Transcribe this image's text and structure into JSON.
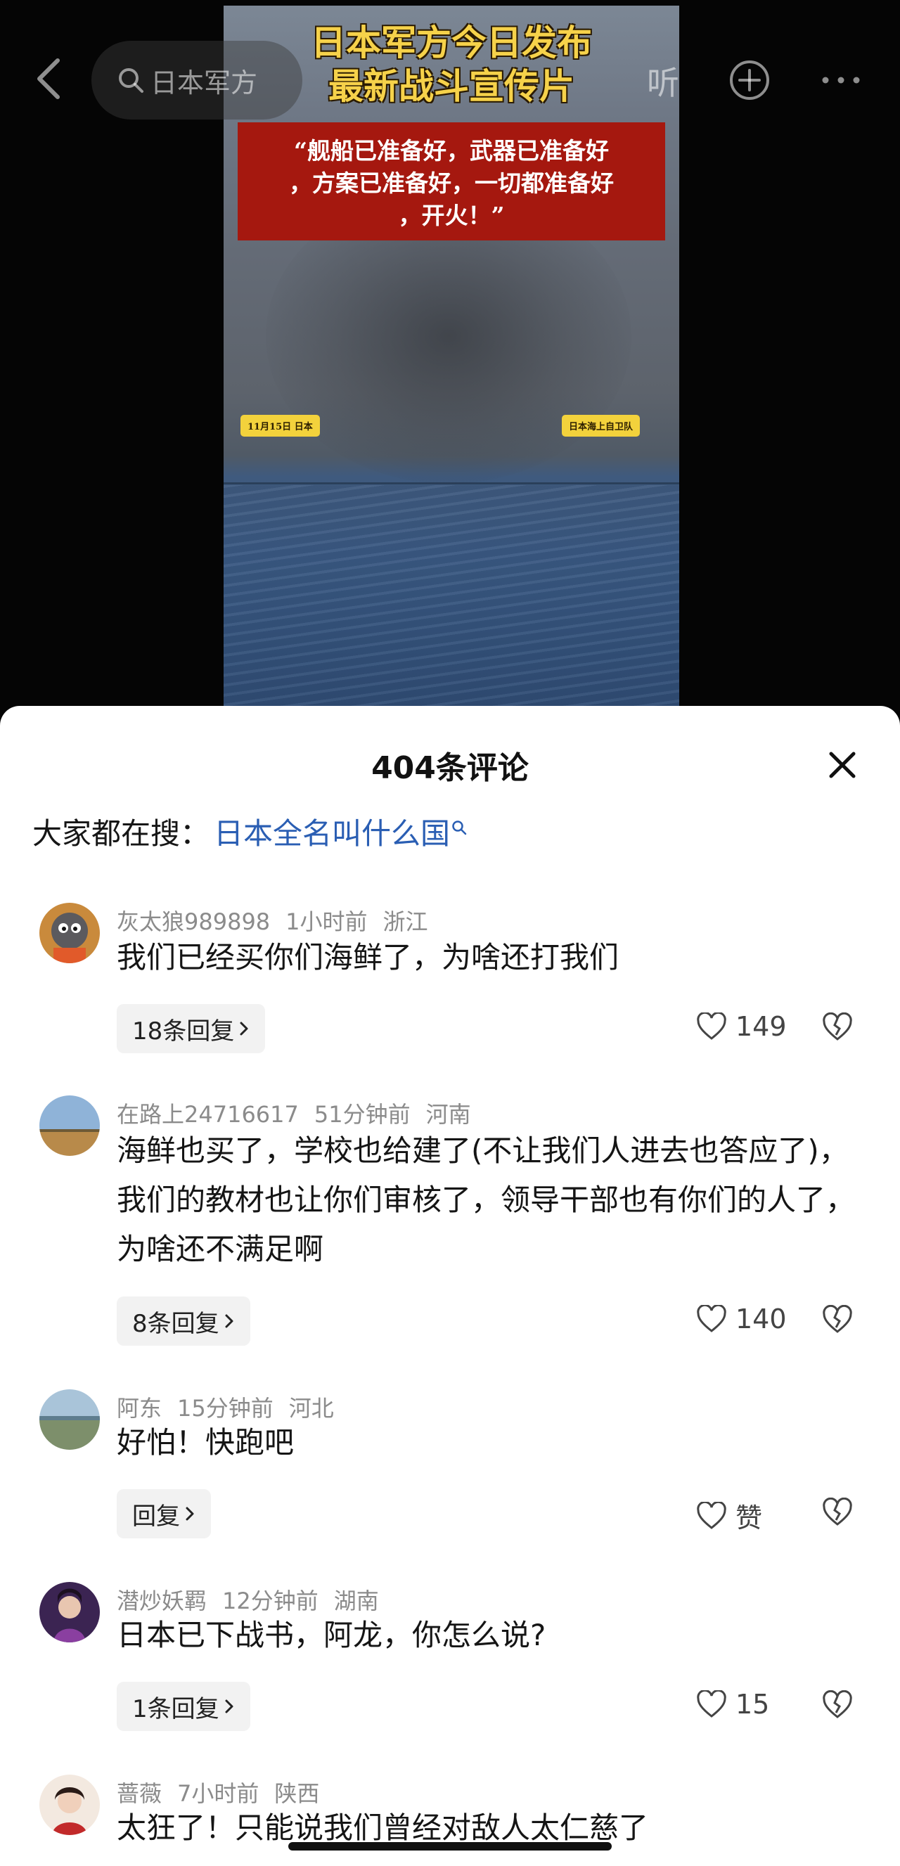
{
  "video": {
    "title_line1": "日本军方今日发布",
    "title_line2": "最新战斗宣传片",
    "quote_line1": "“舰船已准备好，武器已准备好",
    "quote_line2": "，方案已准备好，一切都准备好",
    "quote_line3": "，开火！”",
    "tag_left": "11月15日 日本",
    "tag_right": "日本海上自卫队"
  },
  "topbar": {
    "search_text": "日本军方",
    "listen_label": "听"
  },
  "sheet": {
    "title": "404条评论",
    "hot_search_label": "大家都在搜：",
    "hot_search_link": "日本全名叫什么国"
  },
  "comments": [
    {
      "user": "灰太狼989898",
      "time": "1小时前",
      "location": "浙江",
      "text": "我们已经买你们海鲜了，为啥还打我们",
      "reply": "18条回复",
      "likes": "149"
    },
    {
      "user": "在路上24716617",
      "time": "51分钟前",
      "location": "河南",
      "text": "海鲜也买了，学校也给建了(不让我们人进去也答应了)，我们的教材也让你们审核了，领导干部也有你们的人了，为啥还不满足啊",
      "reply": "8条回复",
      "likes": "140"
    },
    {
      "user": "阿东",
      "time": "15分钟前",
      "location": "河北",
      "text": "好怕！快跑吧",
      "reply": "回复",
      "likes": "赞"
    },
    {
      "user": "潜炒妖羁",
      "time": "12分钟前",
      "location": "湖南",
      "text": "日本已下战书，阿龙，你怎么说?",
      "reply": "1条回复",
      "likes": "15"
    },
    {
      "user": "蔷薇",
      "time": "7小时前",
      "location": "陕西",
      "text": "太狂了！只能说我们曾经对敌人太仁慈了"
    }
  ]
}
